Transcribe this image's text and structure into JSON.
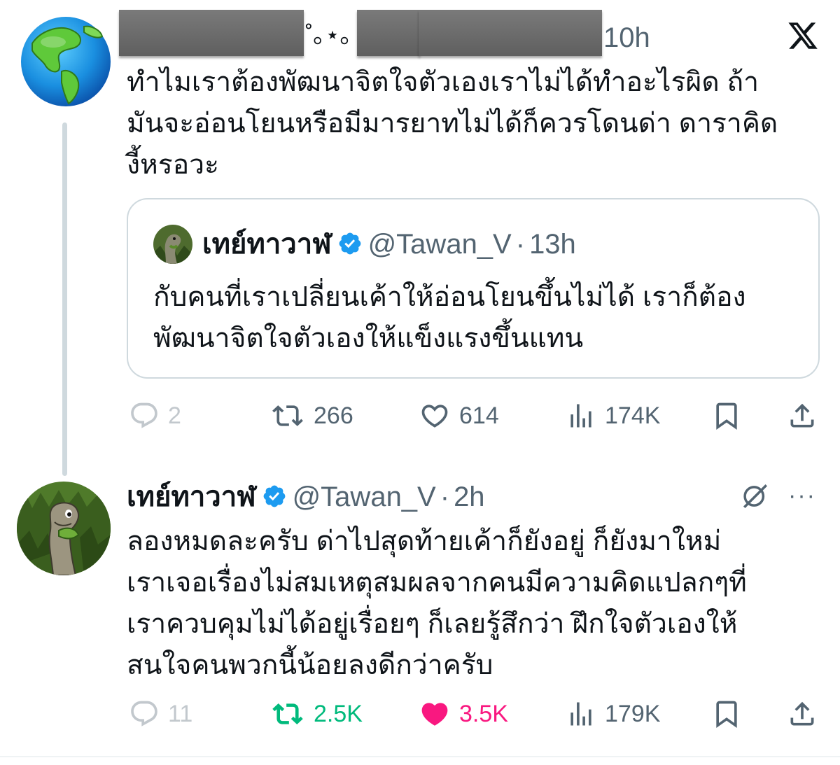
{
  "tweet1": {
    "username_fragment": "˚｡⋆｡",
    "time": "10h",
    "text": "ทำไมเราต้องพัฒนาจิตใจตัวเองเราไม่ได้ทำอะไรผิด ถ้ามันจะอ่อนโยนหรือมีมารยาทไม่ได้ก็ควรโดนด่า ดาราคิดงี้หรอวะ",
    "text_lines": [
      "ทำไมเราต้องพัฒนาจิตใจตัวเองเราไม่ได้ทำอะไรผิด ถ้า",
      "มันจะอ่อนโยนหรือมีมารยาทไม่ได้ก็ควรโดนด่า ดาราคิด",
      "งี้หรอวะ"
    ],
    "quote": {
      "display_name": "เทย์ทาวาฬ",
      "handle": "@Tawan_V",
      "separator": "·",
      "time": "13h",
      "text_lines": [
        "กับคนที่เราเปลี่ยนเค้าให้อ่อนโยนขึ้นไม่ได้ เราก็ต้อง",
        "พัฒนาจิตใจตัวเองให้แข็งแรงขึ้นแทน"
      ]
    },
    "actions": {
      "replies": "2",
      "reposts": "266",
      "likes": "614",
      "views": "174K"
    }
  },
  "tweet2": {
    "display_name": "เทย์ทาวาฬ",
    "handle": "@Tawan_V",
    "separator": "·",
    "time": "2h",
    "more": "···",
    "text_lines": [
      "ลองหมดละครับ ด่าไปสุดท้ายเค้าก็ยังอยู่ ก็ยังมาใหม่",
      "เราเจอเรื่องไม่สมเหตุสมผลจากคนมีความคิดแปลกๆที่",
      "เราควบคุมไม่ได้อยู่เรื่อยๆ ก็เลยรู้สึกว่า ฝึกใจตัวเองให้",
      "สนใจคนพวกนี้น้อยลงดีกว่าครับ"
    ],
    "actions": {
      "replies": "11",
      "reposts": "2.5K",
      "likes": "3.5K",
      "views": "179K"
    }
  },
  "colors": {
    "text": "#0f1419",
    "secondary": "#536471",
    "verified": "#1d9bf0",
    "repost_active": "#00ba7c",
    "like_active": "#f91880",
    "border": "#cfd9de"
  },
  "icons": [
    "x-logo-icon",
    "verified-badge-icon",
    "reply-icon",
    "repost-icon",
    "like-icon",
    "views-icon",
    "bookmark-icon",
    "share-icon",
    "grok-icon",
    "more-icon"
  ]
}
